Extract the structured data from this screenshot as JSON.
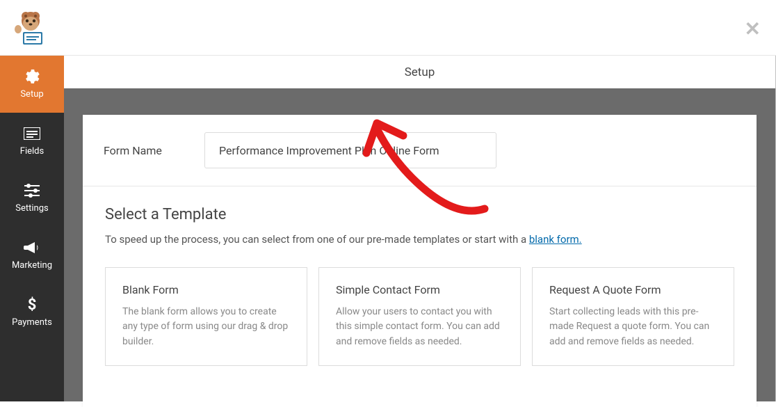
{
  "header": {
    "page_title": "Setup"
  },
  "sidebar": {
    "tabs": [
      {
        "label": "Setup"
      },
      {
        "label": "Fields"
      },
      {
        "label": "Settings"
      },
      {
        "label": "Marketing"
      },
      {
        "label": "Payments"
      }
    ]
  },
  "form_name": {
    "label": "Form Name",
    "value": "Performance Improvement Plan Online Form"
  },
  "templates": {
    "section_title": "Select a Template",
    "desc_prefix": "To speed up the process, you can select from one of our pre-made templates or start with a ",
    "link_text": "blank form.",
    "cards": [
      {
        "title": "Blank Form",
        "desc": "The blank form allows you to create any type of form using our drag & drop builder."
      },
      {
        "title": "Simple Contact Form",
        "desc": "Allow your users to contact you with this simple contact form. You can add and remove fields as needed."
      },
      {
        "title": "Request A Quote Form",
        "desc": "Start collecting leads with this pre-made Request a quote form. You can add and remove fields as needed."
      }
    ]
  }
}
